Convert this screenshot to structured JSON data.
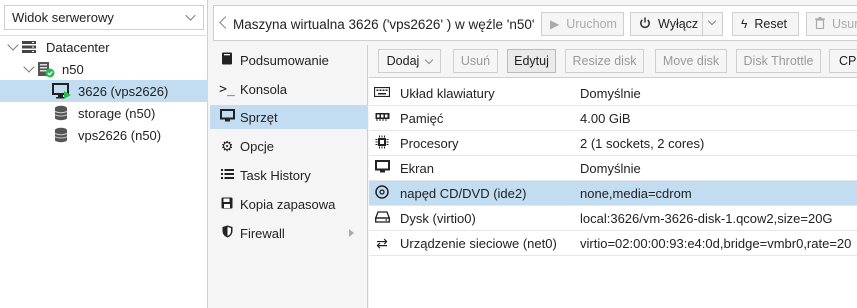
{
  "tree": {
    "view_select": "Widok serwerowy",
    "nodes": [
      {
        "label": "Datacenter"
      },
      {
        "label": "n50"
      },
      {
        "label": "3626 (vps2626)"
      },
      {
        "label": "storage (n50)"
      },
      {
        "label": "vps2626 (n50)"
      }
    ]
  },
  "header": {
    "title": "Maszyna wirtualna 3626 ('vps2626' ) w węźle 'n50'",
    "buttons": {
      "start": "Uruchom",
      "shutdown": "Wyłącz",
      "reset": "Reset",
      "remove": "Usuń"
    }
  },
  "submenu": {
    "items": [
      {
        "label": "Podsumowanie",
        "icon": "book-icon"
      },
      {
        "label": "Konsola",
        "icon": "terminal-icon"
      },
      {
        "label": "Sprzęt",
        "icon": "monitor-icon"
      },
      {
        "label": "Opcje",
        "icon": "gear-icon"
      },
      {
        "label": "Task History",
        "icon": "list-icon"
      },
      {
        "label": "Kopia zapasowa",
        "icon": "save-icon"
      },
      {
        "label": "Firewall",
        "icon": "shield-icon"
      }
    ],
    "active_index": 2
  },
  "toolbar": {
    "add": "Dodaj",
    "remove": "Usuń",
    "edit": "Edytuj",
    "resize_disk": "Resize disk",
    "move_disk": "Move disk",
    "disk_throttle": "Disk Throttle",
    "cpu_options": "CPU"
  },
  "hardware": {
    "rows": [
      {
        "name": "Układ klawiatury",
        "value": "Domyślnie",
        "icon": "keyboard-icon"
      },
      {
        "name": "Pamięć",
        "value": "4.00 GiB",
        "icon": "memory-icon"
      },
      {
        "name": "Procesory",
        "value": "2 (1 sockets, 2 cores)",
        "icon": "cpu-icon"
      },
      {
        "name": "Ekran",
        "value": "Domyślnie",
        "icon": "display-icon"
      },
      {
        "name": "napęd CD/DVD (ide2)",
        "value": "none,media=cdrom",
        "icon": "cdrom-icon"
      },
      {
        "name": "Dysk (virtio0)",
        "value": "local:3626/vm-3626-disk-1.qcow2,size=20G",
        "icon": "hdd-icon"
      },
      {
        "name": "Urządzenie sieciowe (net0)",
        "value": "virtio=02:00:00:93:e4:0d,bridge=vmbr0,rate=20",
        "icon": "network-icon"
      }
    ],
    "selected_index": 4
  },
  "colors": {
    "selection": "#c2ddf2",
    "running_green": "#21bf4b"
  }
}
